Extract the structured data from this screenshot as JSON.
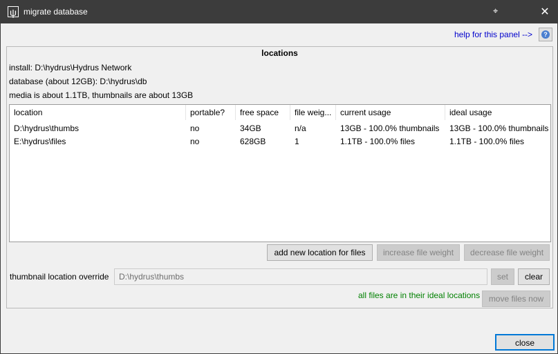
{
  "window": {
    "title": "migrate database",
    "icon": "psi-app-icon",
    "cursor_glyph": "⌖",
    "close_glyph": "✕"
  },
  "help": {
    "link_text": "help for this panel -->",
    "button_icon": "help-icon",
    "button_glyph": "?"
  },
  "locations": {
    "title": "locations",
    "install": "install: D:\\hydrus\\Hydrus Network",
    "database": "database (about 12GB): D:\\hydrus\\db",
    "media_summary": "media is about 1.1TB, thumbnails are about 13GB",
    "columns": [
      "location",
      "portable?",
      "free space",
      "file weig...",
      "current usage",
      "ideal usage"
    ],
    "rows": [
      [
        "D:\\hydrus\\thumbs",
        "no",
        "34GB",
        "n/a",
        "13GB - 100.0% thumbnails",
        "13GB - 100.0% thumbnails"
      ],
      [
        "E:\\hydrus\\files",
        "no",
        "628GB",
        "1",
        "1.1TB - 100.0% files",
        "1.1TB - 100.0% files"
      ]
    ],
    "buttons": {
      "add": "add new location for files",
      "increase": "increase file weight",
      "decrease": "decrease file weight"
    },
    "thumbnail_override": {
      "label": "thumbnail location override",
      "value": "D:\\hydrus\\thumbs",
      "set": "set",
      "clear": "clear"
    },
    "status": "all files are in their ideal locations",
    "move_button": "move files now"
  },
  "footer": {
    "close": "close"
  },
  "colors": {
    "titlebar": "#3c3c3c",
    "link": "#0000cc",
    "status_ok": "#008000",
    "focus": "#0078d7"
  }
}
